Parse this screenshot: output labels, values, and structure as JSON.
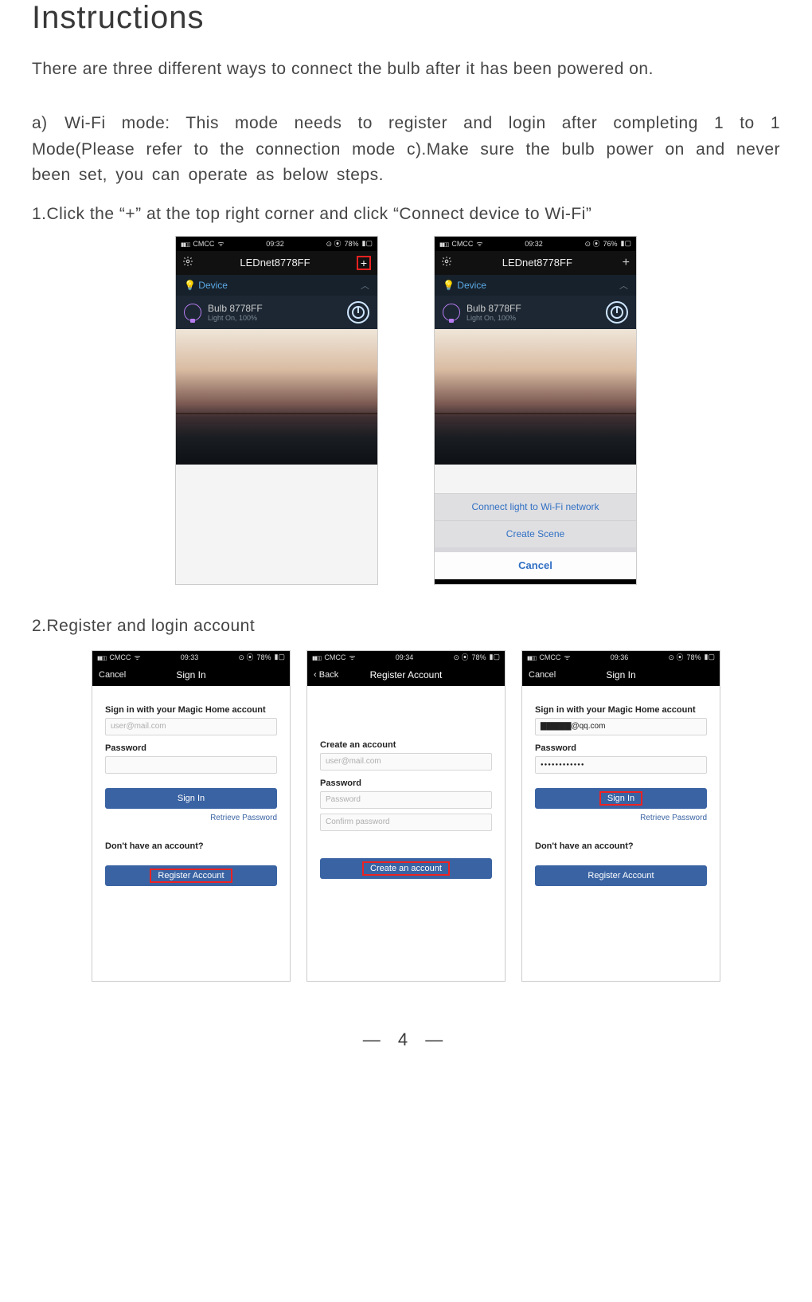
{
  "heading": "Instructions",
  "intro": "There are three different ways to connect the bulb after it has been powered on.",
  "para_a": "a) Wi-Fi mode: This mode needs to register and login after completing 1 to 1 Mode(Please refer to the connection mode c).Make sure the bulb power on and never been set, you can operate as below steps.",
  "step1": "1.Click the “+” at the top right corner and click “Connect device to Wi-Fi”",
  "step2": "2.Register and login account",
  "pagenum": "— 4 —",
  "status": {
    "carrier": "CMCC",
    "t1": "09:32",
    "t2": "09:32",
    "t3": "09:33",
    "t4": "09:34",
    "t5": "09:36",
    "b1": "78%",
    "b2": "76%",
    "b3": "78%",
    "b4": "78%",
    "b5": "78%"
  },
  "app": {
    "title": "LEDnet8778FF",
    "device_label": "Device",
    "bulb_name": "Bulb 8778FF",
    "bulb_sub": "Light On, 100%"
  },
  "sheet": {
    "opt1": "Connect light to Wi-Fi network",
    "opt2": "Create Scene",
    "cancel": "Cancel"
  },
  "signin": {
    "nav": "Sign In",
    "cancel": "Cancel",
    "back": "Back",
    "reg_nav": "Register Account",
    "lbl_signin": "Sign in with your Magic Home account",
    "ph_email": "user@mail.com",
    "lbl_pw": "Password",
    "ph_pw": "Password",
    "ph_confirm": "Confirm password",
    "btn_signin": "Sign In",
    "link_retrieve": "Retrieve Password",
    "q_noacct": "Don't have an account?",
    "btn_register": "Register Account",
    "lbl_create": "Create an account",
    "btn_create": "Create an account",
    "val_email_masked": "▇▇▇▇▇@qq.com",
    "val_pw_dots": "●●●●●●●●●●●●"
  }
}
